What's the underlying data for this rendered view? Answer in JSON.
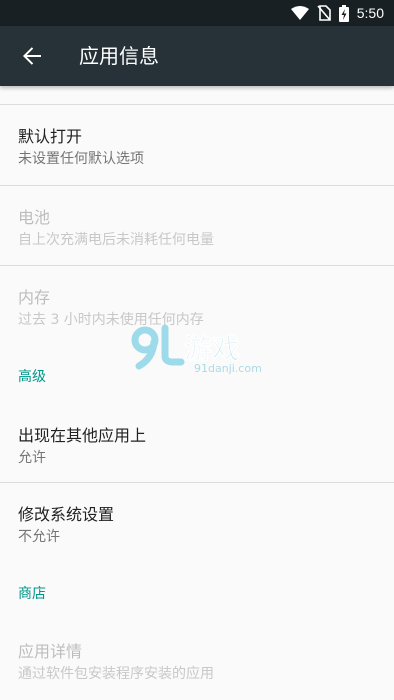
{
  "status_bar": {
    "time": "5:50",
    "icons": [
      "wifi-icon",
      "no-sim-icon",
      "battery-charging-icon"
    ],
    "color": "#182024"
  },
  "app_bar": {
    "title": "应用信息",
    "back_icon": "arrow-back-icon",
    "color": "#263238"
  },
  "items": {
    "default_open": {
      "title": "默认打开",
      "summary": "未设置任何默认选项"
    },
    "battery": {
      "title": "电池",
      "summary": "自上次充满电后未消耗任何电量"
    },
    "memory": {
      "title": "内存",
      "summary": "过去 3 小时内未使用任何内存"
    },
    "draw_over_apps": {
      "title": "出现在其他应用上",
      "summary": "允许"
    },
    "modify_settings": {
      "title": "修改系统设置",
      "summary": "不允许"
    },
    "app_details": {
      "title": "应用详情",
      "summary": "通过软件包安装程序安装的应用"
    }
  },
  "sections": {
    "advanced": "高级",
    "store": "商店"
  },
  "watermark": {
    "logo_text": "9L游戏",
    "url": "91danji.com"
  },
  "colors": {
    "accent": "#009688",
    "text_primary": "#212121",
    "text_secondary": "#757575",
    "text_disabled": "#bdbdbd"
  }
}
